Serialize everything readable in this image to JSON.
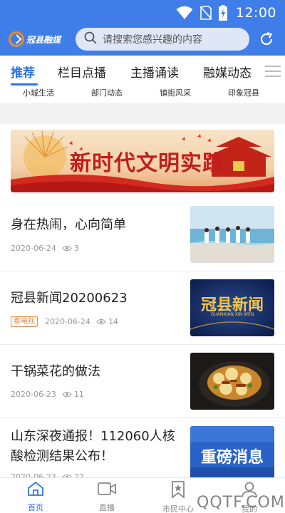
{
  "status_bar": {
    "time": "12:00"
  },
  "header": {
    "logo_text": "冠县融媒",
    "search_placeholder": "请搜索您感兴趣的内容"
  },
  "tabs": [
    {
      "label": "推荐",
      "active": true
    },
    {
      "label": "栏目点播",
      "active": false
    },
    {
      "label": "主播诵读",
      "active": false
    },
    {
      "label": "融媒动态",
      "active": false
    }
  ],
  "subcategories": [
    "小城生活",
    "部门动态",
    "镇街风采",
    "印象冠县"
  ],
  "banner": {
    "title": "新时代文明实践"
  },
  "articles": [
    {
      "title": "身在热闹，心向简单",
      "date": "2020-06-24",
      "views": "3",
      "badge": ""
    },
    {
      "title": "冠县新闻20200623",
      "date": "2020-06-24",
      "views": "14",
      "badge": "看电视",
      "thumb_text": "冠县新闻",
      "thumb_sub": "GUANXIAN XIN WEN"
    },
    {
      "title": "干锅菜花的做法",
      "date": "2020-06-23",
      "views": "11",
      "badge": ""
    },
    {
      "title": "山东深夜通报！112060人核酸检测结果公布！",
      "date": "2020-06-23",
      "views": "22",
      "badge": "",
      "thumb_text": "重磅消息"
    }
  ],
  "bottom_nav": [
    {
      "label": "首页",
      "icon": "home-icon",
      "active": true
    },
    {
      "label": "直播",
      "icon": "video-icon",
      "active": false
    },
    {
      "label": "市民中心",
      "icon": "bookmark-star-icon",
      "active": false
    },
    {
      "label": "我的",
      "icon": "user-icon",
      "active": false
    }
  ],
  "watermark": "QQTF.COM",
  "colors": {
    "primary": "#3f7ee8",
    "tab_active": "#2f73e6",
    "badge": "#e8893b"
  }
}
